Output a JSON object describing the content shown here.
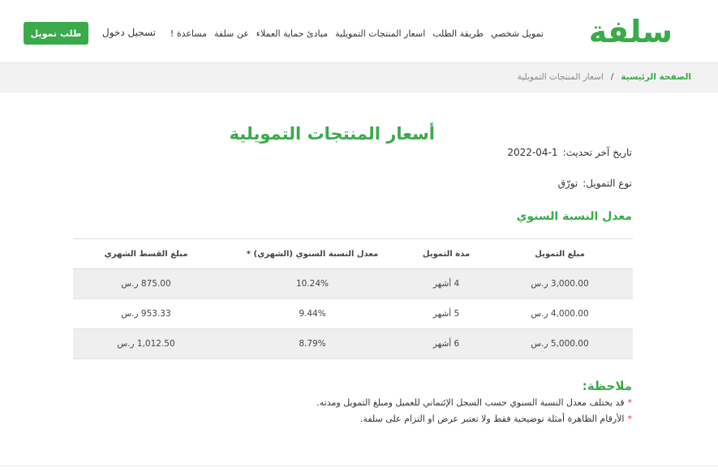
{
  "header": {
    "logo_text": "سلفة",
    "nav": [
      {
        "label": "تمويل شخصي"
      },
      {
        "label": "طريقة الطلب"
      },
      {
        "label": "اسعار المنتجات التمويلية"
      },
      {
        "label": "مبادئ حماية العملاء"
      },
      {
        "label": "عن سلفة"
      },
      {
        "label": "مساعدة !"
      }
    ],
    "login_label": "تسجيل دخول",
    "cta_label": "طلب تمويل"
  },
  "breadcrumb": {
    "home": "الصفحة الرئيسية",
    "separator": "/",
    "current": "اسعار المنتجات التمويلية"
  },
  "page": {
    "title": "أسعار المنتجات التمويلية",
    "last_update_label": "تاريخ آخر تحديث:",
    "last_update_value": "1-04-2022",
    "finance_type_label": "نوع التمويل:",
    "finance_type_value": "تورّق",
    "section_title": "معدل النسبة السنوي"
  },
  "table": {
    "headers": {
      "amount": "مبلغ التمويل",
      "term": "مدة التمويل",
      "rate": "معدل النسبة السنوي (الشهري) *",
      "monthly": "مبلغ القسط الشهري"
    },
    "rows": [
      {
        "amount": "3,000.00 ر.س",
        "term": "4 أشهر",
        "rate": "10.24%",
        "monthly": "875.00 ر.س"
      },
      {
        "amount": "4,000.00 ر.س",
        "term": "5 أشهر",
        "rate": "9.44%",
        "monthly": "953.33 ر.س"
      },
      {
        "amount": "5,000.00 ر.س",
        "term": "6 أشهر",
        "rate": "8.79%",
        "monthly": "1,012.50 ر.س"
      }
    ]
  },
  "notes": {
    "title": "ملاحظة:",
    "star": "*",
    "items": [
      "قد يختلف معدل النسبة السنوي حسب السجل الإئتماني للعميل ومبلغ التمويل ومدته.",
      "الأرقام الظاهرة أمثلة توضيحية فقط ولا تعتبر عرض او التزام على سلفة."
    ]
  },
  "colors": {
    "brand_green": "#3aaa4a",
    "note_star": "#e53935",
    "row_alt": "#efefef"
  }
}
